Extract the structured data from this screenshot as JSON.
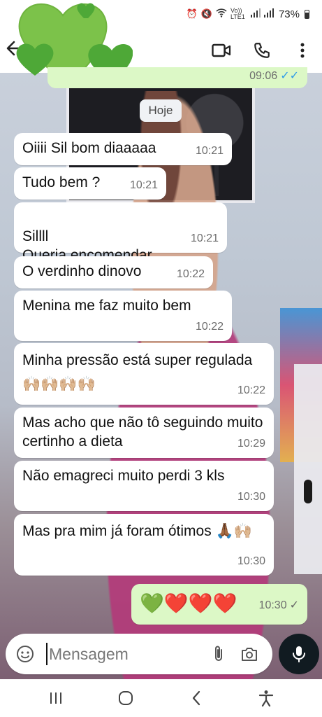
{
  "status_bar": {
    "network_label": "Vo)) LTE1",
    "battery_percent": "73%"
  },
  "header": {
    "icons": [
      "back-arrow-icon",
      "video-call-icon",
      "phone-icon",
      "more-options-icon"
    ]
  },
  "chat": {
    "top_outgoing": {
      "time": "09:06",
      "status": "read"
    },
    "date_label": "Hoje",
    "messages": [
      {
        "direction": "in",
        "text": "Oiiii Sil bom diaaaaa",
        "time": "10:21"
      },
      {
        "direction": "in",
        "text": "Tudo bem ?",
        "time": "10:21"
      },
      {
        "direction": "in",
        "text": "Sillll\nQueria encomendar",
        "time": "10:21"
      },
      {
        "direction": "in",
        "text": "O verdinho dinovo",
        "time": "10:22"
      },
      {
        "direction": "in",
        "text": "Menina me faz muito bem",
        "time": "10:22"
      },
      {
        "direction": "in",
        "text": "Minha pressão está super regulada 🙌🏼🙌🏼🙌🏼🙌🏼",
        "time": "10:22"
      },
      {
        "direction": "in",
        "text": "Mas acho que não tô seguindo muito certinho a dieta",
        "time": "10:29"
      },
      {
        "direction": "in",
        "text": "Não emagreci muito perdi 3 kls",
        "time": "10:30"
      },
      {
        "direction": "in",
        "text": "Mas pra mim já foram ótimos 🙏🏾🙌🏼",
        "time": "10:30"
      },
      {
        "direction": "out",
        "text": "💚❤️❤️❤️",
        "time": "10:30",
        "status": "delivered"
      }
    ]
  },
  "input": {
    "placeholder": "Mensagem"
  },
  "nav": {
    "icons": [
      "recent-apps-icon",
      "home-icon",
      "back-icon",
      "accessibility-icon"
    ]
  },
  "colors": {
    "outgoing_bubble": "#dcf8c6",
    "incoming_bubble": "#ffffff",
    "read_tick": "#2f9be8",
    "mic_button": "#111b21",
    "sticker_green": "#7cc24a"
  }
}
